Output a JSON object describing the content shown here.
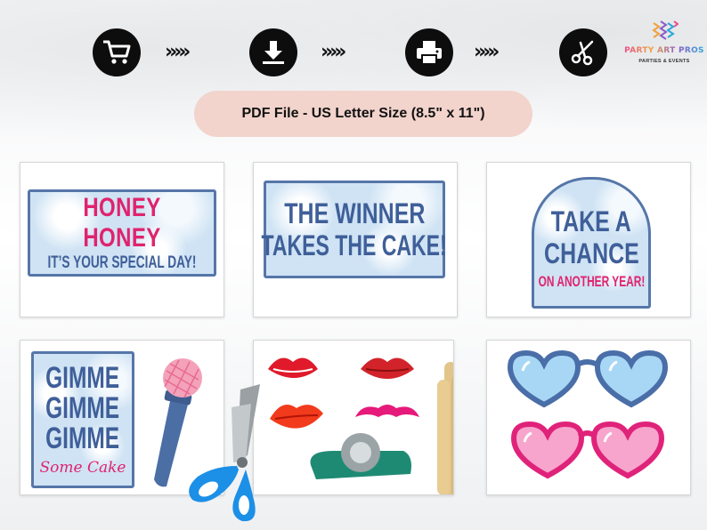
{
  "steps": [
    {
      "name": "cart-icon"
    },
    {
      "name": "download-icon"
    },
    {
      "name": "printer-icon"
    },
    {
      "name": "scissors-icon"
    }
  ],
  "chevrons": "›››››",
  "logo": {
    "title": "PARTY ART PROS",
    "subtitle": "PARTIES & EVENTS"
  },
  "banner": {
    "text": "PDF File - US Letter Size (8.5\" x 11\")"
  },
  "colors": {
    "blue_text": "#3f5f99",
    "pink_text": "#e0236e",
    "sign_border": "#5676a8",
    "pill": "#f2d4cc"
  },
  "cards": {
    "honey": {
      "line1": "HONEY HONEY",
      "line2": "IT’S YOUR SPECIAL DAY!"
    },
    "winner": {
      "line1": "THE WINNER",
      "line2": "TAKES THE CAKE!"
    },
    "chance": {
      "line1": "TAKE A",
      "line2": "CHANCE",
      "line3": "ON ANOTHER YEAR!"
    },
    "gimme": {
      "line1": "GIMME",
      "line2": "GIMME",
      "line3": "GIMME",
      "line4": "Some Cake"
    }
  }
}
